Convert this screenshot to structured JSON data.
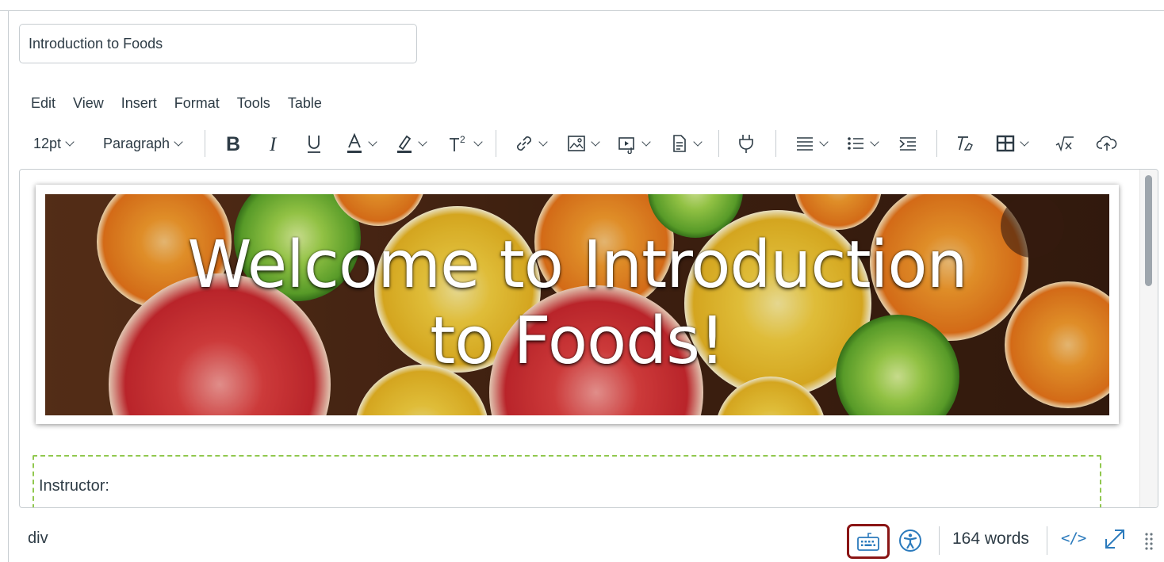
{
  "title_input": {
    "value": "Introduction to Foods"
  },
  "menubar": {
    "items": [
      "Edit",
      "View",
      "Insert",
      "Format",
      "Tools",
      "Table"
    ]
  },
  "toolbar": {
    "font_size": "12pt",
    "block_format": "Paragraph",
    "icons": [
      "bold-icon",
      "italic-icon",
      "underline-icon",
      "text-color-icon",
      "highlight-icon",
      "superscript-icon",
      "link-icon",
      "image-icon",
      "media-icon",
      "document-icon",
      "plugin-icon",
      "align-icon",
      "list-icon",
      "indent-icon",
      "clear-format-icon",
      "table-icon",
      "equation-icon",
      "cloud-upload-icon"
    ]
  },
  "content": {
    "banner_line1": "Welcome to Introduction",
    "banner_line2": "to Foods!",
    "instructor_label": "Instructor:"
  },
  "statusbar": {
    "path": "div",
    "word_count": "164 words",
    "html_editor_label": "</>"
  },
  "colors": {
    "text": "#2d3b45",
    "border": "#c7cdd1",
    "accent_blue": "#2b7abc",
    "highlight_red": "#8a1515",
    "dashed_green": "#91c84f"
  }
}
